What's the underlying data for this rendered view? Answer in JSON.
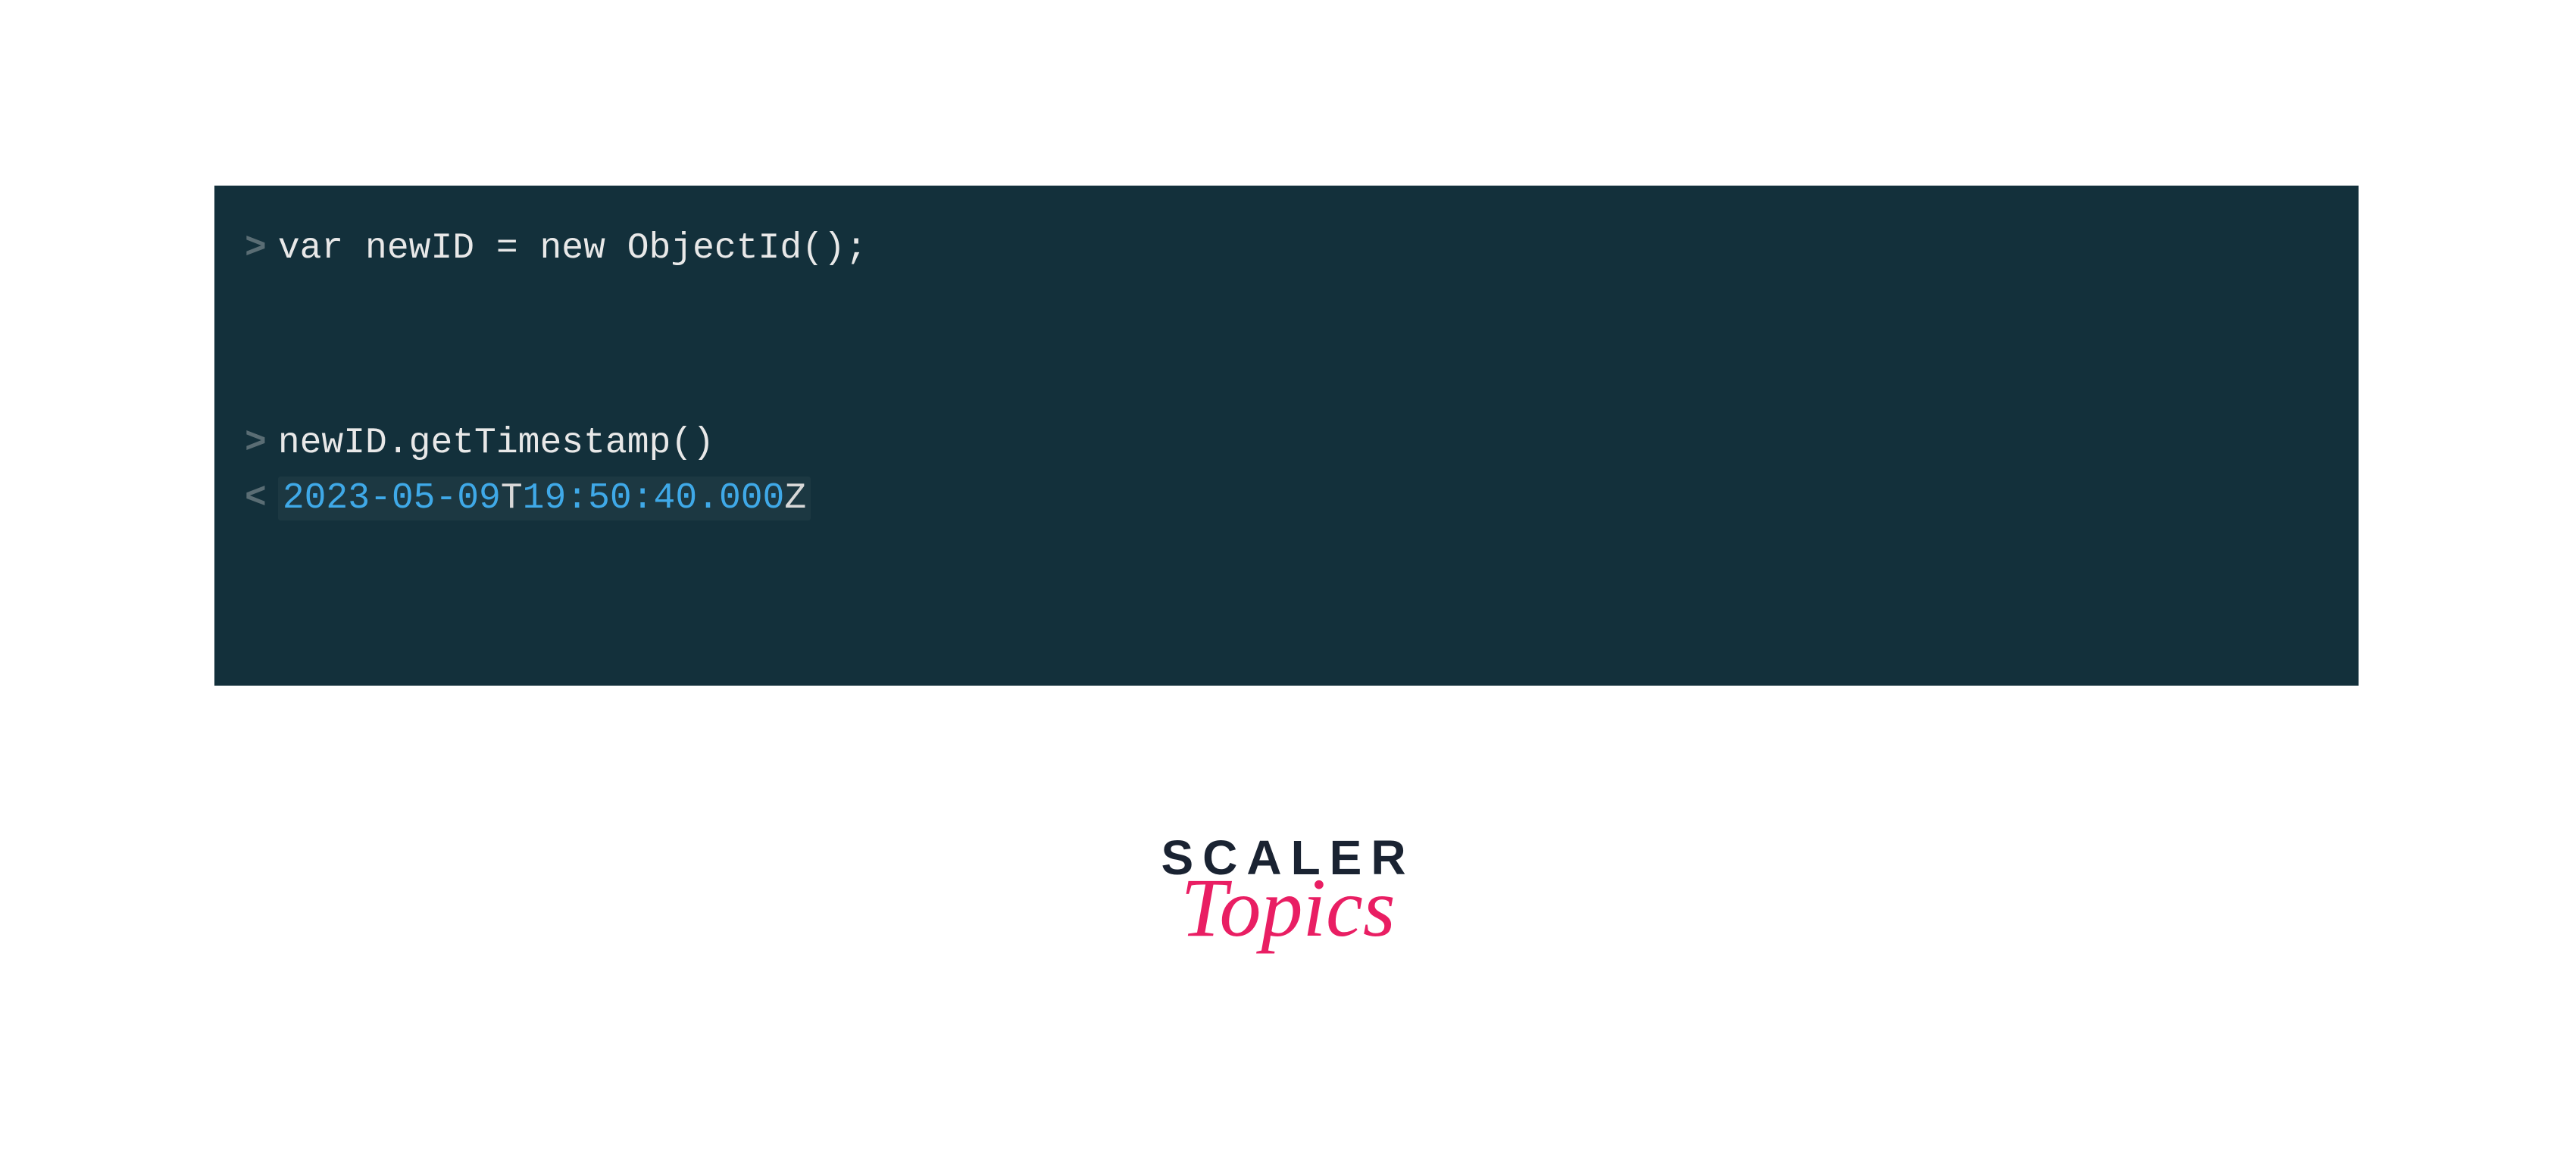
{
  "terminal": {
    "line1": {
      "prompt": ">",
      "code": "var newID = new ObjectId();"
    },
    "line2": {
      "prompt": ">",
      "code": "newID.getTimestamp()"
    },
    "output": {
      "prompt": "<",
      "date": "2023-05-09",
      "t": "T",
      "hour": "19",
      "colon1": ":",
      "minute": "50",
      "colon2": ":",
      "second": "40",
      "dot": ".",
      "ms": "000",
      "z": "Z"
    }
  },
  "logo": {
    "scaler": "SCALER",
    "topics": "Topics"
  }
}
